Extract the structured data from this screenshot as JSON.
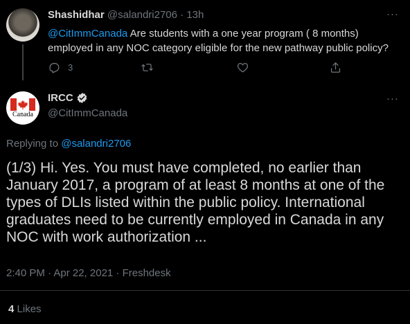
{
  "parent_tweet": {
    "display_name": "Shashidhar",
    "handle": "@salandri2706",
    "separator": " · ",
    "time": "13h",
    "more": "···",
    "mention": "@CitImmCanada",
    "text": " Are students with a one year program ( 8 months) employed in any NOC category eligible for the new pathway public policy?",
    "reply_count": "3"
  },
  "main_tweet": {
    "display_name": "IRCC",
    "handle": "@CitImmCanada",
    "more": "···",
    "avatar_text": "Canada",
    "replying_prefix": "Replying to ",
    "replying_to": "@salandri2706",
    "text": "(1/3) Hi. Yes. You must have completed, no earlier than January 2017, a program of at least 8 months at one of the types of DLIs listed within the public policy. International graduates need to be currently employed in Canada in any NOC with work authorization ...",
    "timestamp": "2:40 PM · Apr 22, 2021 · Freshdesk",
    "likes_count": "4",
    "likes_label": "Likes"
  },
  "colors": {
    "background": "#000000",
    "link": "#1d9bf0",
    "muted": "#6e767d",
    "text": "#d9d9d9",
    "flag_red": "#d52b1e"
  },
  "icons": [
    "reply-icon",
    "retweet-icon",
    "like-icon",
    "share-icon",
    "verified-badge-icon",
    "more-icon"
  ]
}
